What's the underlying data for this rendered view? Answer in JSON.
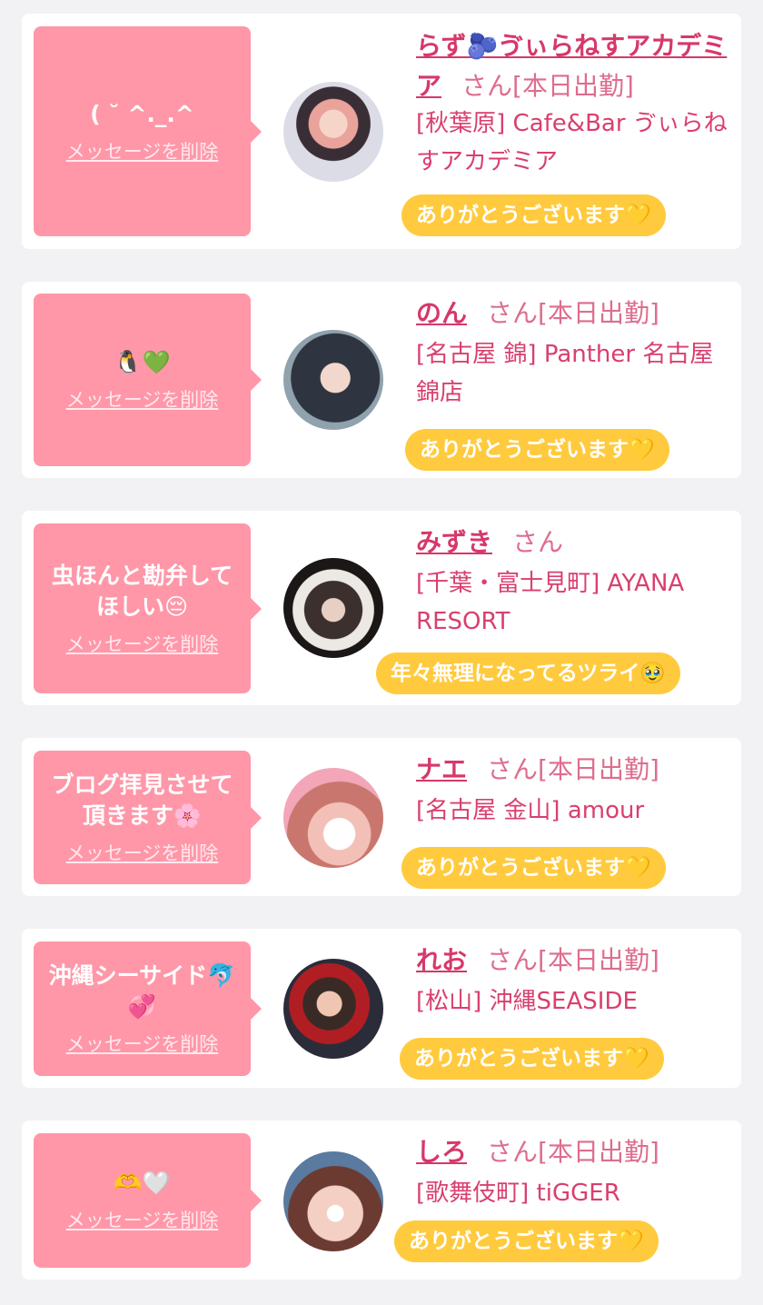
{
  "delete_label": "メッセージを削除",
  "san_label": "さん",
  "cards": [
    {
      "message": "( ˘ ^._.^",
      "name": "らず🫐ゔぃらねすアカデミア",
      "duty": "[本日出勤]",
      "shop": "[秋葉原] Cafe&Bar ゔぃらねすアカデミア",
      "reply": "ありがとうございます💛"
    },
    {
      "message": "🐧💚",
      "name": "のん",
      "duty": "[本日出勤]",
      "shop": "[名古屋 錦] Panther 名古屋錦店",
      "reply": "ありがとうございます💛"
    },
    {
      "message": "虫ほんと勘弁してほしい😔",
      "name": "みずき",
      "duty": "",
      "shop": "[千葉・富士見町] AYANA RESORT",
      "reply": "年々無理になってるツライ🥹"
    },
    {
      "message": "ブログ拝見させて頂きます🌸",
      "name": "ナエ",
      "duty": "[本日出勤]",
      "shop": "[名古屋 金山] amour",
      "reply": "ありがとうございます💛"
    },
    {
      "message": "沖縄シーサイド🐬💞",
      "name": "れお",
      "duty": "[本日出勤]",
      "shop": "[松山] 沖縄SEASIDE",
      "reply": "ありがとうございます💛"
    },
    {
      "message": "🫶🤍",
      "name": "しろ",
      "duty": "[本日出勤]",
      "shop": "[歌舞伎町] tiGGER",
      "reply": "ありがとうございます💛"
    }
  ]
}
